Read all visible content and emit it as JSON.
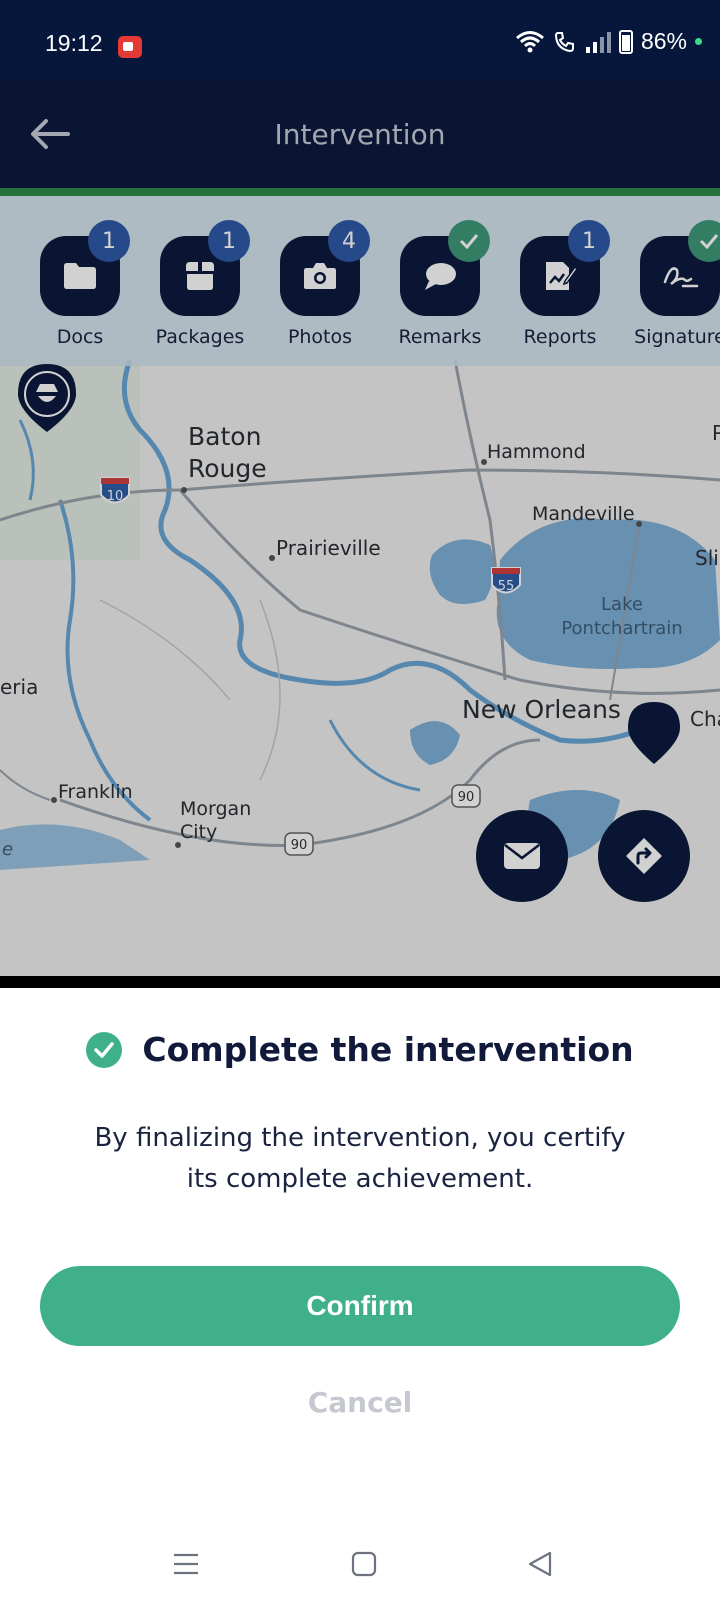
{
  "status_bar": {
    "time": "19:12",
    "battery": "86%"
  },
  "app_bar": {
    "title": "Intervention"
  },
  "tabs": [
    {
      "label": "Docs",
      "badge": "1",
      "badge_type": "count",
      "icon": "folder-icon"
    },
    {
      "label": "Packages",
      "badge": "1",
      "badge_type": "count",
      "icon": "package-icon"
    },
    {
      "label": "Photos",
      "badge": "4",
      "badge_type": "count",
      "icon": "camera-icon"
    },
    {
      "label": "Remarks",
      "badge": "",
      "badge_type": "check",
      "icon": "chat-bubble-icon"
    },
    {
      "label": "Reports",
      "badge": "1",
      "badge_type": "count",
      "icon": "report-edit-icon"
    },
    {
      "label": "Signature",
      "badge": "",
      "badge_type": "check",
      "icon": "signature-icon"
    }
  ],
  "map": {
    "labels": {
      "baton": "Baton",
      "rouge": "Rouge",
      "hammond": "Hammond",
      "mandeville": "Mandeville",
      "prairieville": "Prairieville",
      "lake": "Lake",
      "pontchartrain": "Pontchartrain",
      "new_orleans": "New Orleans",
      "eria": "eria",
      "franklin": "Franklin",
      "morgan": "Morgan",
      "city": "City",
      "sli": "Sli",
      "cha": "Cha",
      "p": "P",
      "e": "e"
    },
    "shields": {
      "i10": "10",
      "i55": "55",
      "us90a": "90",
      "us90b": "90"
    }
  },
  "sheet": {
    "title": "Complete the intervention",
    "text_line1": "By finalizing the intervention, you certify",
    "text_line2": "its complete achievement.",
    "confirm_label": "Confirm",
    "cancel_label": "Cancel"
  },
  "colors": {
    "navy": "#0b1a3f",
    "accent_green": "#3fb08a",
    "badge_blue": "#2f5aa8",
    "water": "#7fb0d8"
  }
}
